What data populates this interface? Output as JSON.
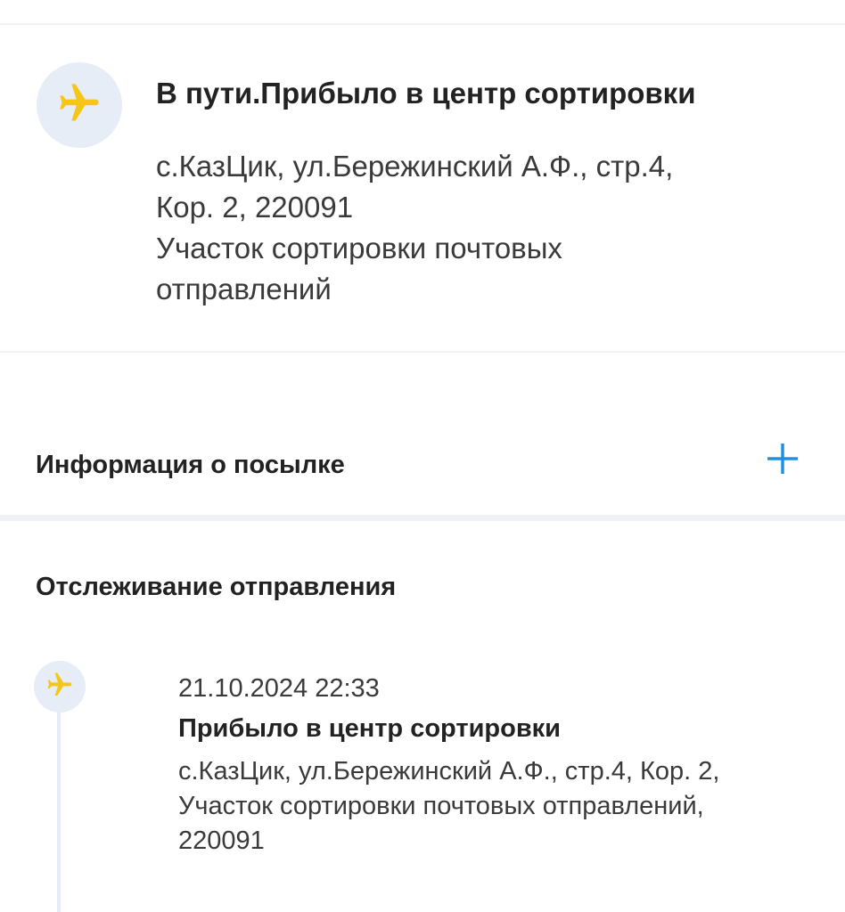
{
  "status_card": {
    "icon": "airplane-icon",
    "title": "В пути.Прибыло в центр сортировки",
    "address_lines": [
      "с.КазЦик, ул.Бережинский А.Ф., стр.4,",
      "Кор. 2, 220091",
      "Участок сортировки почтовых",
      "отправлений"
    ]
  },
  "parcel_info": {
    "title": "Информация о посылке",
    "expand_icon": "plus-icon"
  },
  "tracking": {
    "title": "Отслеживание отправления",
    "events": [
      {
        "icon": "airplane-icon",
        "datetime": "21.10.2024 22:33",
        "title": "Прибыло в центр сортировки",
        "address_lines": [
          "с.КазЦик, ул.Бережинский А.Ф., стр.4, Кор. 2,",
          "Участок сортировки почтовых отправлений,",
          "220091"
        ]
      }
    ]
  },
  "colors": {
    "accent_yellow": "#f5c518",
    "accent_blue": "#1a8fe3",
    "icon_background": "#e6edf6",
    "divider": "#eef1f5"
  }
}
